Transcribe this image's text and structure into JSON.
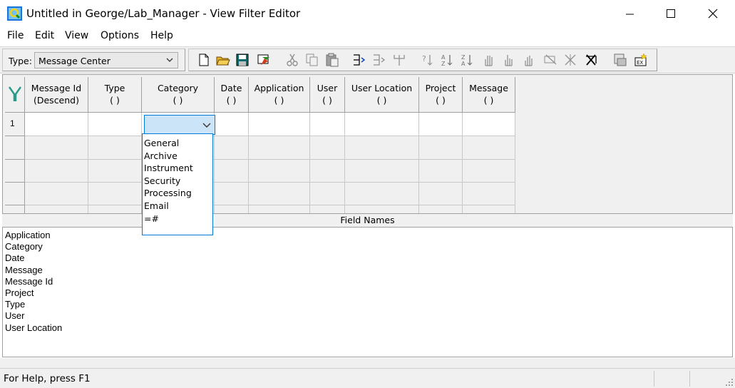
{
  "window": {
    "title": "Untitled in George/Lab_Manager - View Filter Editor"
  },
  "menu": {
    "items": [
      "File",
      "Edit",
      "View",
      "Options",
      "Help"
    ]
  },
  "toolbar": {
    "type_label": "Type:",
    "type_value": "Message Center"
  },
  "grid": {
    "columns": [
      {
        "line1": "Message Id",
        "line2": "(Descend)"
      },
      {
        "line1": "Type",
        "line2": "( )"
      },
      {
        "line1": "Category",
        "line2": "( )"
      },
      {
        "line1": "Date",
        "line2": "( )"
      },
      {
        "line1": "Application",
        "line2": "( )"
      },
      {
        "line1": "User",
        "line2": "( )"
      },
      {
        "line1": "User Location",
        "line2": "( )"
      },
      {
        "line1": "Project",
        "line2": "( )"
      },
      {
        "line1": "Message",
        "line2": "( )"
      }
    ],
    "row_number": "1"
  },
  "category_dropdown": {
    "options": [
      "General",
      "Archive",
      "Instrument",
      "Security",
      "Processing",
      "Email",
      "=#"
    ]
  },
  "field_names": {
    "header": "Field Names",
    "items": [
      "Application",
      "Category",
      "Date",
      "Message",
      "Message Id",
      "Project",
      "Type",
      "User",
      "User Location"
    ]
  },
  "status": {
    "text": "For Help, press F1"
  }
}
